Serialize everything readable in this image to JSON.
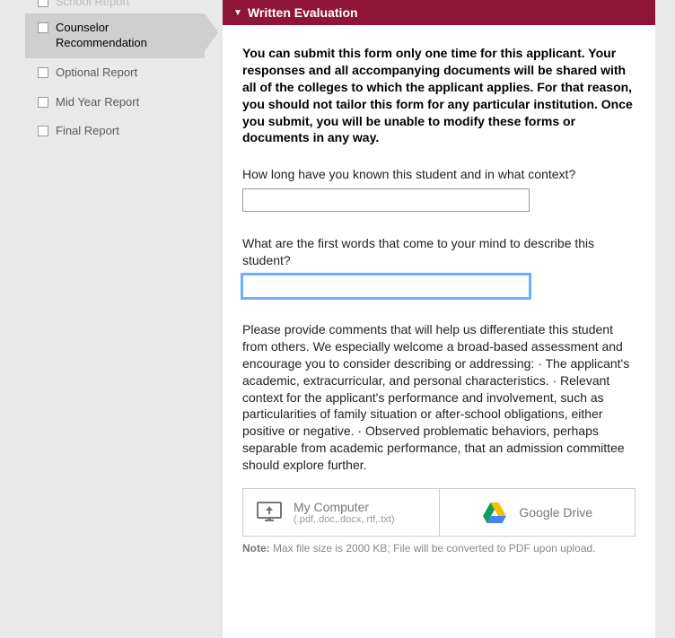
{
  "sidebar": {
    "items": [
      {
        "label": "School Report",
        "active": false,
        "cutoff": true
      },
      {
        "label": "Counselor Recommendation",
        "active": true
      },
      {
        "label": "Optional Report",
        "active": false
      },
      {
        "label": "Mid Year Report",
        "active": false
      },
      {
        "label": "Final Report",
        "active": false
      }
    ]
  },
  "section": {
    "title": "Written Evaluation",
    "intro": "You can submit this form only one time for this applicant. Your responses and all accompanying documents will be shared with all of the colleges to which the applicant applies. For that reason, you should not tailor this form for any particular institution. Once you submit, you will be unable to modify these forms or documents in any way.",
    "q1": "How long have you known this student and in what context?",
    "q1_value": "",
    "q2": "What are the first words that come to your mind to describe this student?",
    "q2_value": "",
    "q3": "Please provide comments that will help us differentiate this student from others. We especially welcome a broad-based assessment and encourage you to consider describing or addressing: · The applicant's academic, extracurricular, and personal characteristics. · Relevant context for the applicant's performance and involvement, such as particularities of family situation or after-school obligations, either positive or negative. · Observed problematic behaviors, perhaps separable from academic performance, that an admission committee should explore further."
  },
  "upload": {
    "computer_label": "My Computer",
    "computer_types": "(.pdf,.doc,.docx,.rtf,.txt)",
    "drive_label": "Google Drive",
    "note_prefix": "Note:",
    "note_text": " Max file size is 2000 KB; File will be converted to PDF upon upload."
  }
}
